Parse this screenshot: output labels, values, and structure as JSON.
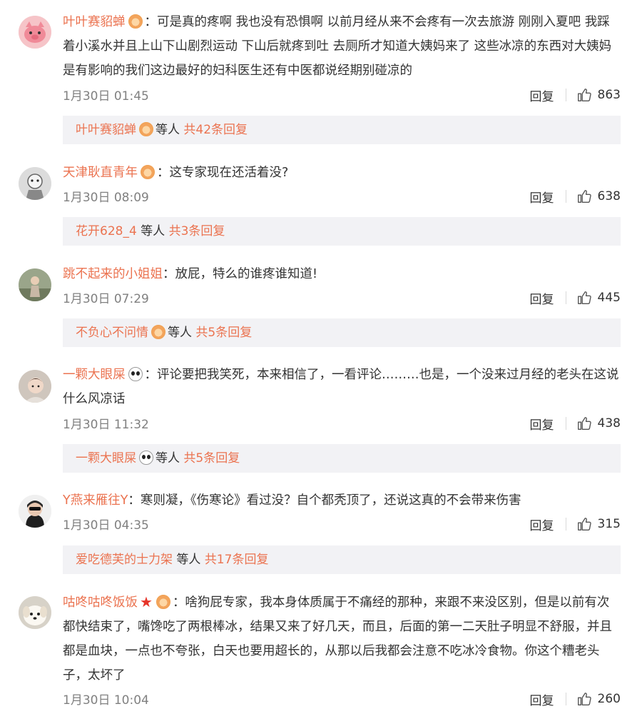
{
  "colors": {
    "accent": "#eb7350",
    "muted": "#808080",
    "reply_bg": "#f2f2f5"
  },
  "common": {
    "reply_label": "回复",
    "like_icon": "thumbs-up-icon",
    "etc_label": "等人"
  },
  "comments": [
    {
      "user": "叶叶赛貂蝉",
      "badge": "flame-badge-icon",
      "text": "：可是真的疼啊 我也没有恐惧啊 以前月经从来不会疼有一次去旅游 刚刚入夏吧 我踩着小溪水并且上山下山剧烈运动 下山后就疼到吐 去厕所才知道大姨妈来了 这些冰凉的东西对大姨妈是有影响的我们这边最好的妇科医生还有中医都说经期别碰凉的",
      "time": "1月30日 01:45",
      "likes": "863",
      "reply_user": "叶叶赛貂蝉",
      "reply_total": "共42条回复"
    },
    {
      "user": "天津耿直青年",
      "badge": "flame-badge-icon",
      "text": "：这专家现在还活着没?",
      "time": "1月30日 08:09",
      "likes": "638",
      "reply_user": "花开628_4",
      "reply_total": "共3条回复"
    },
    {
      "user": "跳不起来的小姐姐",
      "text": "：放屁，特么的谁疼谁知道!",
      "time": "1月30日 07:29",
      "likes": "445",
      "reply_user": "不负心不问情",
      "reply_total": "共5条回复"
    },
    {
      "user": "一颗大眼屎",
      "badge": "panda-badge-icon",
      "text": "：评论要把我笑死，本来相信了，一看评论………也是，一个没来过月经的老头在这说什么风凉话",
      "time": "1月30日 11:32",
      "likes": "438",
      "reply_user": "一颗大眼屎",
      "reply_total": "共5条回复"
    },
    {
      "user": "Y燕来雁往Y",
      "text": "：寒则凝，《伤寒论》看过没？自个都秃顶了，还说这真的不会带来伤害",
      "time": "1月30日 04:35",
      "likes": "315",
      "reply_user": "爱吃德芙的士力架",
      "reply_total": "共17条回复"
    },
    {
      "user": "咕咚咕咚饭饭",
      "badge": "star-badge-icon",
      "text": "：啥狗屁专家，我本身体质属于不痛经的那种，来跟不来没区别，但是以前有次都快结束了，嘴馋吃了两根棒冰，结果又来了好几天，而且，后面的第一二天肚子明显不舒服，并且都是血块，一点也不夸张，白天也要用超长的，从那以后我都会注意不吃冰冷食物。你这个糟老头子，太坏了",
      "time": "1月30日 10:04",
      "likes": "260"
    }
  ]
}
